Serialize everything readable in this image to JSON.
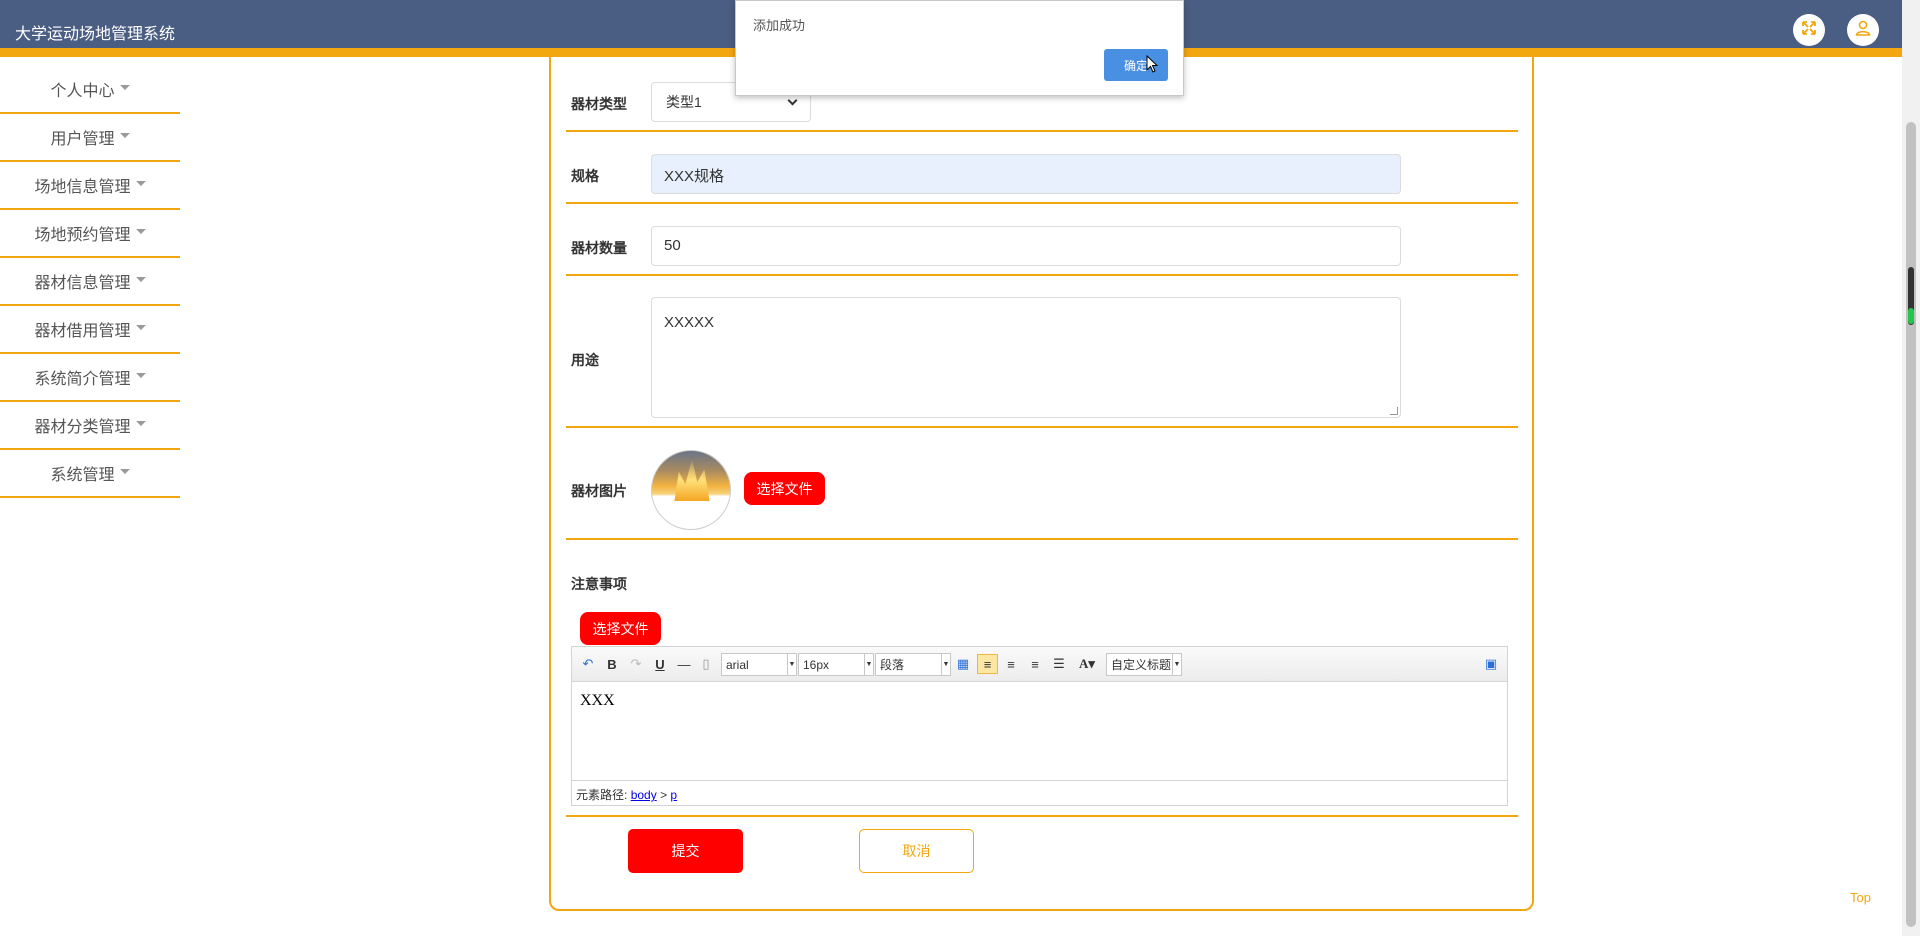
{
  "header": {
    "title": "大学运动场地管理系统",
    "fullscreen_icon": "expand-arrows-icon",
    "user_icon": "user-icon",
    "accent_color": "#f2a60f",
    "bar_color": "#4a5d82"
  },
  "sidebar": {
    "items": [
      {
        "label": "个人中心"
      },
      {
        "label": "用户管理"
      },
      {
        "label": "场地信息管理"
      },
      {
        "label": "场地预约管理"
      },
      {
        "label": "器材信息管理"
      },
      {
        "label": "器材借用管理"
      },
      {
        "label": "系统简介管理"
      },
      {
        "label": "器材分类管理"
      },
      {
        "label": "系统管理"
      }
    ]
  },
  "form": {
    "type_label": "器材类型",
    "type_value": "类型1",
    "spec_label": "规格",
    "spec_value": "XXX规格",
    "quantity_label": "器材数量",
    "quantity_value": "50",
    "usage_label": "用途",
    "usage_value": "XXXXX",
    "image_label": "器材图片",
    "choose_file": "选择文件",
    "notes_label": "注意事项",
    "notes_choose_file": "选择文件",
    "submit": "提交",
    "cancel": "取消"
  },
  "editor": {
    "font": "arial",
    "size": "16px",
    "paragraph": "段落",
    "custom_title": "自定义标题",
    "content": "XXX",
    "path_label": "元素路径:",
    "path_body": "body",
    "path_sep": ">",
    "path_p": "p"
  },
  "dialog": {
    "message": "添加成功",
    "ok": "确定"
  },
  "top_link": "Top"
}
